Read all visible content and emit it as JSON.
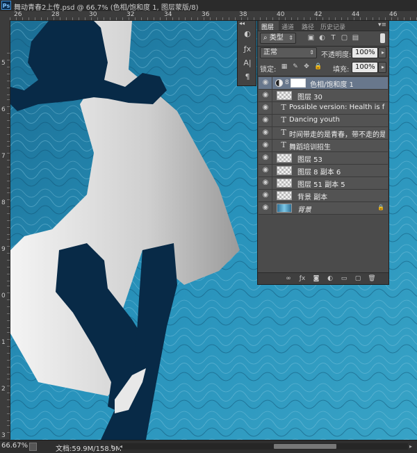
{
  "window": {
    "app_icon": "Ps",
    "title": "舞动青春2上传.psd @ 66.7% (色相/饱和度 1, 图层蒙版/8)"
  },
  "rulers": {
    "top_labels": [
      "26",
      "28",
      "30",
      "32",
      "34",
      "36",
      "38",
      "40",
      "42",
      "44",
      "46"
    ],
    "left_labels": [
      "5",
      "6",
      "7",
      "8",
      "9",
      "0",
      "1",
      "2",
      "3"
    ]
  },
  "status": {
    "zoom": "66.67%",
    "doc_info": "文档:59.9M/158.9M"
  },
  "layers_panel": {
    "tabs": [
      "图层",
      "通道",
      "路径",
      "历史记录"
    ],
    "active_tab": "图层",
    "filter_kind": "类型",
    "blend_mode": "正常",
    "opacity_label": "不透明度:",
    "opacity_value": "100%",
    "lock_label": "锁定:",
    "fill_label": "填充:",
    "fill_value": "100%",
    "layers": [
      {
        "name": "色相/饱和度 1",
        "kind": "adjustment",
        "selected": true
      },
      {
        "name": "图层 30",
        "kind": "pixel",
        "selected": false
      },
      {
        "name": "Possible version: Health is far more valuable",
        "kind": "text",
        "selected": false
      },
      {
        "name": "Dancing  youth",
        "kind": "text",
        "selected": false
      },
      {
        "name": "时间带走的是青春，带不走的是舞蹈",
        "kind": "text",
        "selected": false
      },
      {
        "name": "舞蹈培训招生",
        "kind": "text",
        "selected": false
      },
      {
        "name": "图层 53",
        "kind": "pixel",
        "selected": false
      },
      {
        "name": "图层 8 副本 6",
        "kind": "pixel",
        "selected": false
      },
      {
        "name": "图层 51 副本 5",
        "kind": "pixel",
        "selected": false
      },
      {
        "name": "背景 副本",
        "kind": "pixel",
        "selected": false
      },
      {
        "name": "背景",
        "kind": "background",
        "selected": false
      }
    ]
  },
  "icons": {
    "eye": "eye-icon",
    "text_layer": "T",
    "panel_bottom": [
      "link-layers-icon",
      "fx-icon",
      "add-mask-icon",
      "new-adjustment-icon",
      "new-group-icon",
      "new-layer-icon",
      "delete-layer-icon"
    ]
  },
  "colors": {
    "selected_layer": "#68778c",
    "panel_bg": "#4b4b4b",
    "canvas_blue": "#1f86ae",
    "silhouette": "#082a47"
  }
}
